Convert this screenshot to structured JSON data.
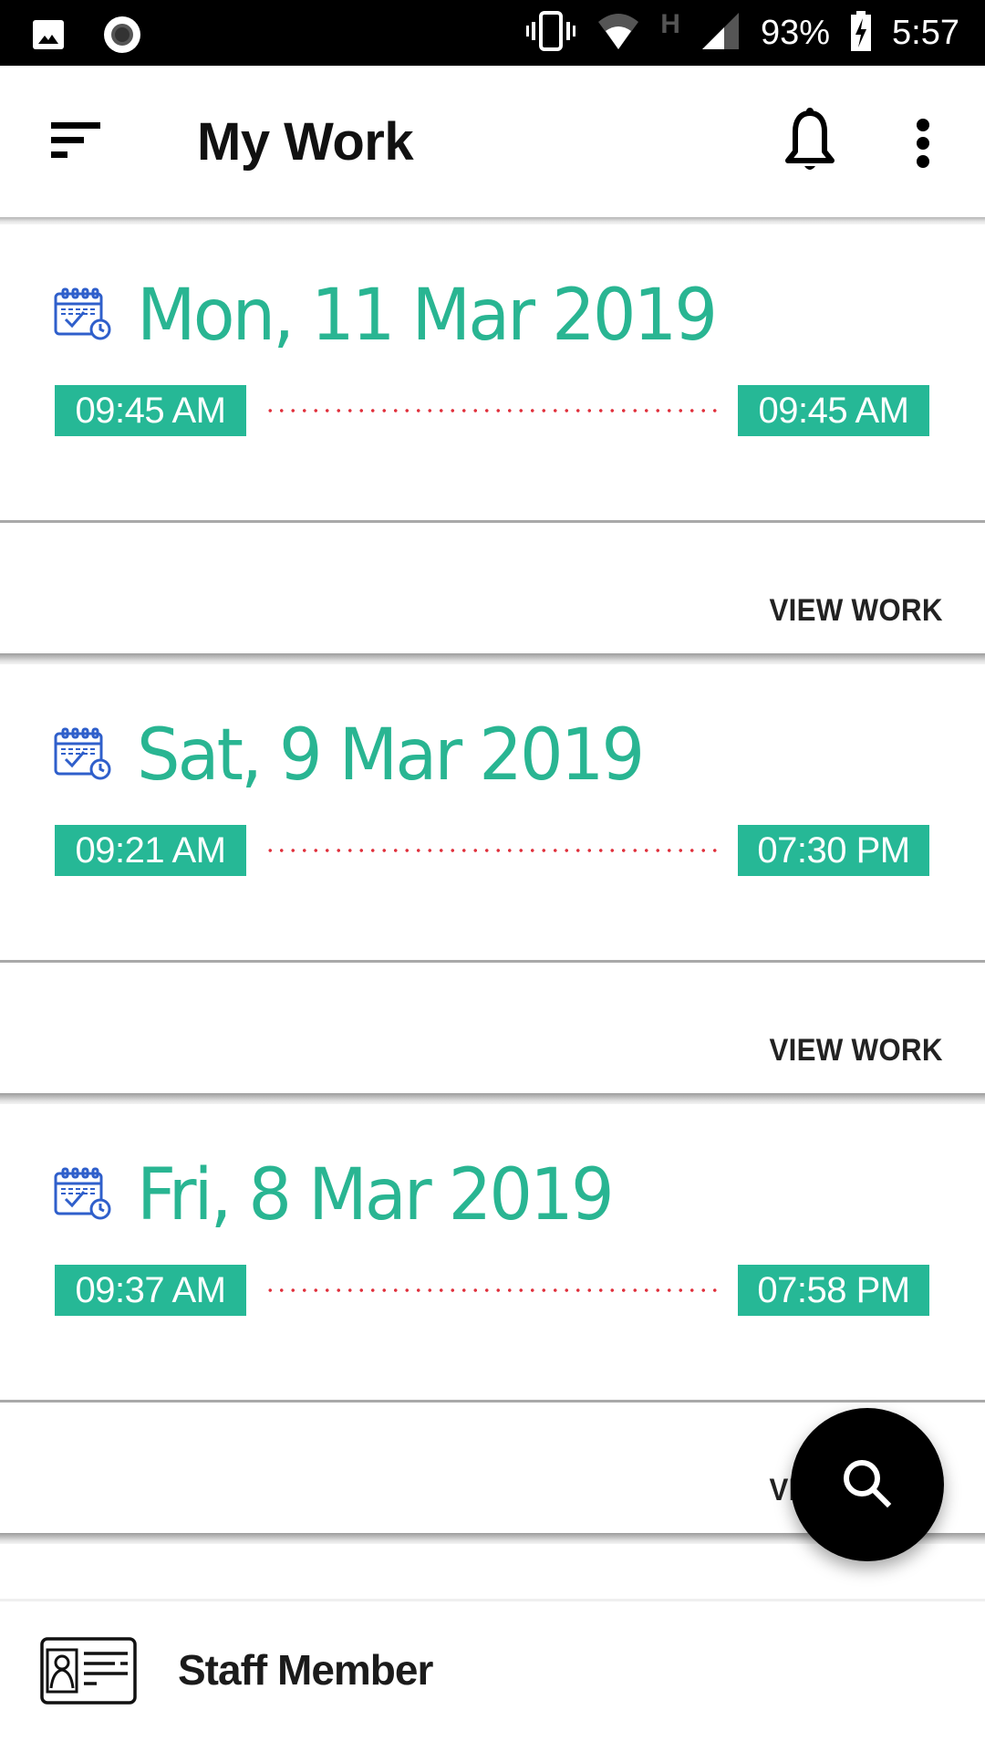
{
  "status_bar": {
    "battery": "93%",
    "time": "5:57",
    "network_label": "H",
    "icons": [
      "gallery-icon",
      "record-icon",
      "vibrate-icon",
      "wifi-icon",
      "network-h-icon",
      "signal-icon",
      "battery-charging-icon"
    ]
  },
  "app_bar": {
    "title": "My Work",
    "menu_icon": "sort-menu-icon",
    "notification_icon": "bell-icon",
    "more_icon": "more-vert-icon"
  },
  "work_entries": [
    {
      "date": "Mon, 11 Mar 2019",
      "start_time": "09:45 AM",
      "end_time": "09:45 AM",
      "action": "VIEW WORK"
    },
    {
      "date": "Sat, 9 Mar 2019",
      "start_time": "09:21 AM",
      "end_time": "07:30 PM",
      "action": "VIEW WORK"
    },
    {
      "date": "Fri, 8 Mar 2019",
      "start_time": "09:37 AM",
      "end_time": "07:58 PM",
      "action": "VIEW WORK"
    }
  ],
  "fab": {
    "icon": "search-icon",
    "label": "Search"
  },
  "bottom_bar": {
    "label": "Staff Member",
    "icon": "id-card-icon"
  },
  "colors": {
    "accent_green": "#26B896",
    "date_text": "#29B592",
    "dotted_line": "#E0303C",
    "calendar_icon": "#2F5FCB"
  }
}
